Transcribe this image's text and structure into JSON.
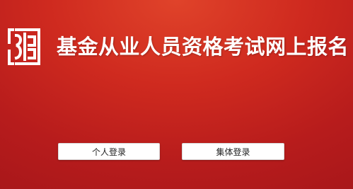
{
  "header": {
    "title": "基金从业人员资格考试网上报名",
    "logo_icon": "seal-logo-icon"
  },
  "login": {
    "personal_label": "个人登录",
    "group_label": "集体登录"
  },
  "colors": {
    "background_top": "#e0432a",
    "background_bottom": "#a8171a",
    "text": "#ffffff",
    "button_bg": "#ffffff"
  }
}
